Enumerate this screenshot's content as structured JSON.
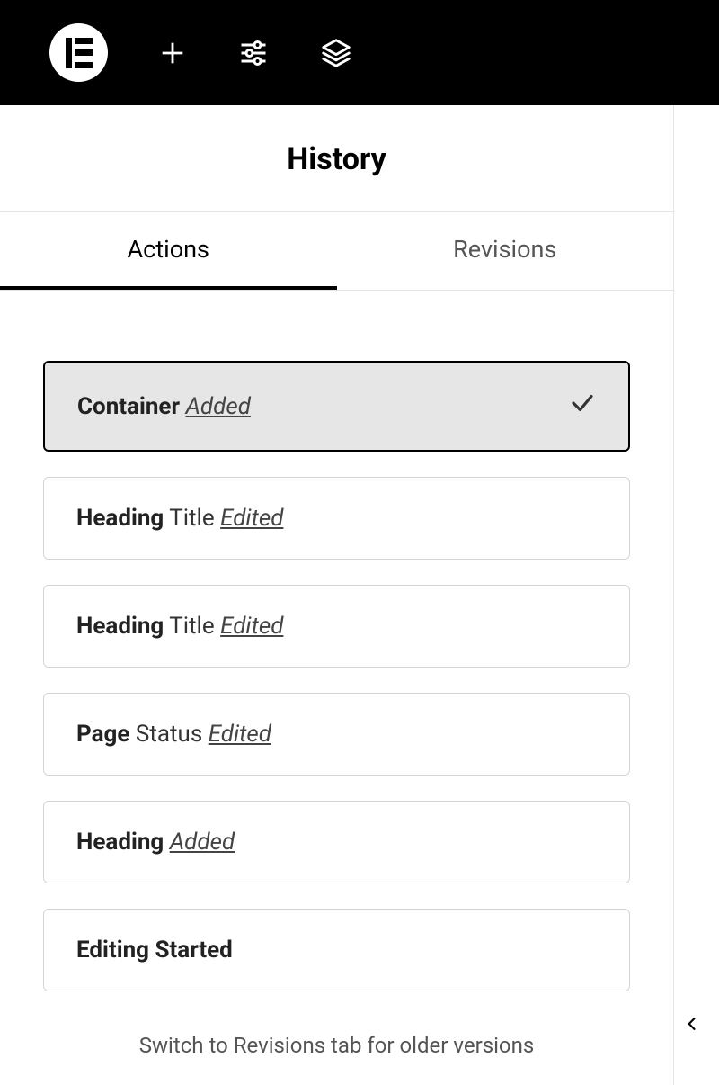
{
  "topbar": {
    "icons": {
      "logo": "elementor-logo",
      "add": "plus-icon",
      "settings": "sliders-icon",
      "navigator": "layers-icon"
    }
  },
  "panel": {
    "title": "History"
  },
  "tabs": [
    {
      "label": "Actions",
      "active": true
    },
    {
      "label": "Revisions",
      "active": false
    }
  ],
  "history_items": [
    {
      "element": "Container",
      "property": "",
      "action": "Added",
      "selected": true
    },
    {
      "element": "Heading",
      "property": "Title",
      "action": "Edited",
      "selected": false
    },
    {
      "element": "Heading",
      "property": "Title",
      "action": "Edited",
      "selected": false
    },
    {
      "element": "Page",
      "property": "Status",
      "action": "Edited",
      "selected": false
    },
    {
      "element": "Heading",
      "property": "",
      "action": "Added",
      "selected": false
    },
    {
      "element": "Editing Started",
      "property": "",
      "action": "",
      "selected": false
    }
  ],
  "footer": {
    "text": "Switch to Revisions tab for older versions"
  }
}
